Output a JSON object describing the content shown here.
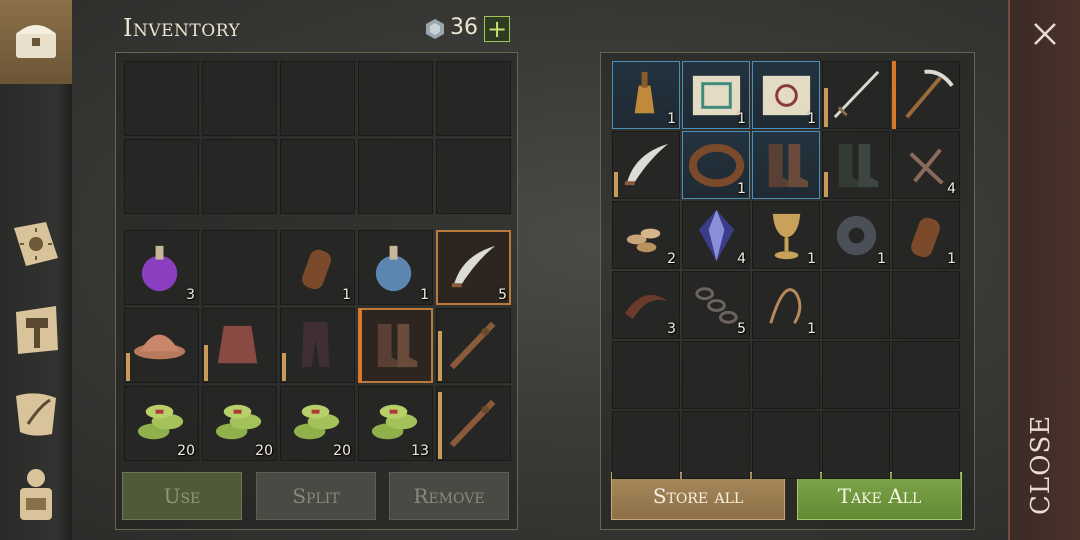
{
  "header": {
    "title": "Inventory",
    "currency_count": "36",
    "add_label": "+"
  },
  "inventory": {
    "top_slots": 10,
    "grid": [
      {
        "item": "purple-potion-icon",
        "count": "3"
      },
      {
        "item": "",
        "count": ""
      },
      {
        "item": "leather-flask-icon",
        "count": "1"
      },
      {
        "item": "blue-potion-icon",
        "count": "1"
      },
      {
        "item": "scimitar-icon",
        "count": "5",
        "selected": true
      },
      {
        "item": "iron-helmet-icon",
        "count": "",
        "bar": 0.4
      },
      {
        "item": "chainmail-icon",
        "count": "",
        "bar": 0.5
      },
      {
        "item": "leather-pants-icon",
        "count": "",
        "bar": 0.4
      },
      {
        "item": "leather-boots-icon",
        "count": "",
        "selected": true,
        "orange": true
      },
      {
        "item": "spiked-club-icon",
        "count": "",
        "bar": 0.7
      },
      {
        "item": "coin-stack-icon",
        "count": "20"
      },
      {
        "item": "coin-stack-icon",
        "count": "20"
      },
      {
        "item": "coin-stack-icon",
        "count": "20"
      },
      {
        "item": "coin-stack-icon",
        "count": "13"
      },
      {
        "item": "spiked-club-icon",
        "count": "",
        "bar": 0.95
      }
    ],
    "buttons": {
      "use": "Use",
      "split": "Split",
      "remove": "Remove"
    }
  },
  "storage": {
    "grid": [
      {
        "item": "bell-icon",
        "count": "1",
        "blue": true
      },
      {
        "item": "scroll-green-icon",
        "count": "1",
        "blue": true
      },
      {
        "item": "scroll-red-icon",
        "count": "1",
        "blue": true
      },
      {
        "item": "sword-icon",
        "count": "",
        "bar": 0.55
      },
      {
        "item": "pickaxe-icon",
        "count": "",
        "orange": true
      },
      {
        "item": "scimitar-icon",
        "count": "",
        "bar": 0.35
      },
      {
        "item": "leather-collar-icon",
        "count": "1",
        "blue": true
      },
      {
        "item": "leather-boots-icon",
        "count": "",
        "blue": true
      },
      {
        "item": "dark-boots-icon",
        "count": "",
        "bar": 0.35
      },
      {
        "item": "nails-icon",
        "count": "4"
      },
      {
        "item": "seeds-icon",
        "count": "2"
      },
      {
        "item": "crystal-icon",
        "count": "4"
      },
      {
        "item": "goblet-icon",
        "count": "1"
      },
      {
        "item": "gear-icon",
        "count": "1"
      },
      {
        "item": "leather-flask-icon",
        "count": "1"
      },
      {
        "item": "leather-strap-icon",
        "count": "3"
      },
      {
        "item": "chain-icon",
        "count": "5"
      },
      {
        "item": "rope-icon",
        "count": "1"
      }
    ],
    "buttons": {
      "store_all": "Store all",
      "take_all": "Take All"
    }
  },
  "close": {
    "label": "CLOSE"
  },
  "colors": {
    "accent_green": "#a5c35b",
    "accent_orange": "#d8782a",
    "rare_blue": "#4a8fb5"
  }
}
